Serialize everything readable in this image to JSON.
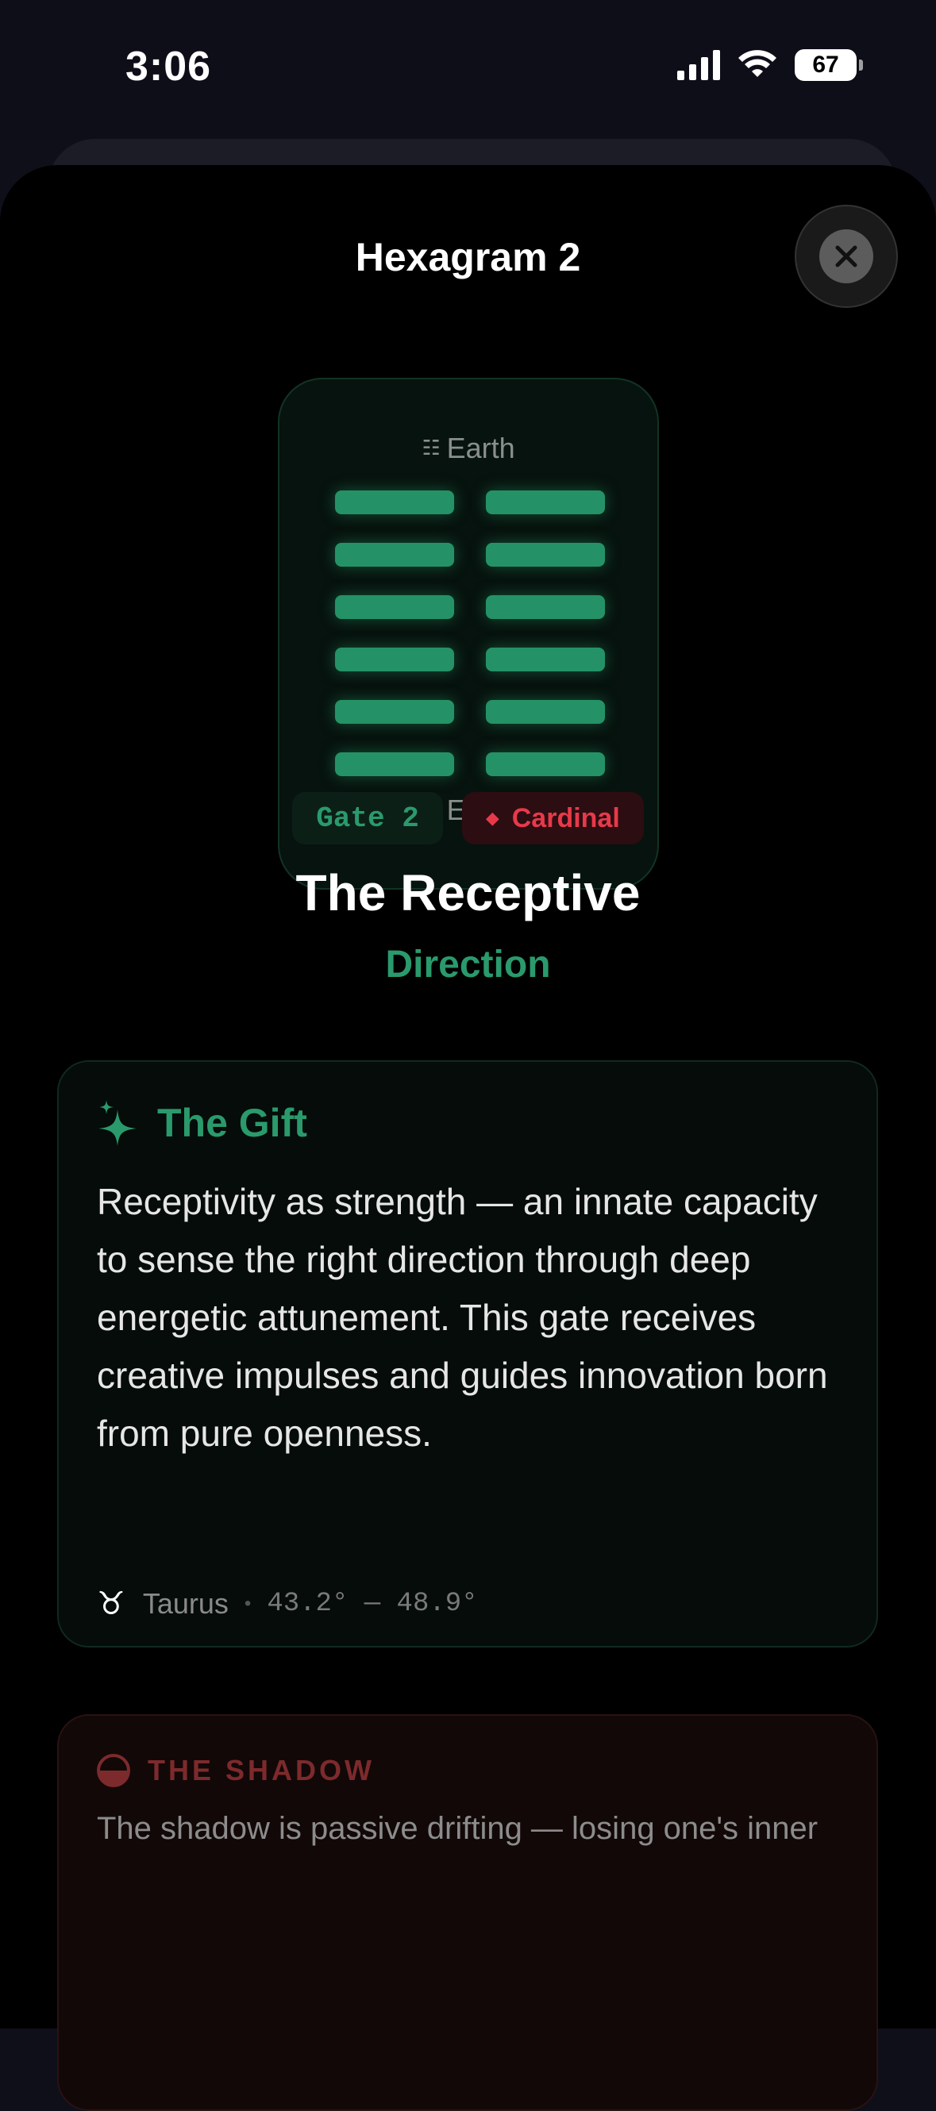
{
  "status_bar": {
    "time": "3:06",
    "battery": "67"
  },
  "sheet": {
    "title": "Hexagram 2",
    "close_label": "✕"
  },
  "hexagram": {
    "upper_trigram": "Earth",
    "lower_trigram": "Earth",
    "trigram_icon": "☷",
    "lines": [
      "yin",
      "yin",
      "yin",
      "yin",
      "yin",
      "yin"
    ],
    "line_color": "#249266"
  },
  "chips": {
    "gate": "Gate 2",
    "mode": "Cardinal",
    "mode_icon": "◆"
  },
  "title": {
    "name": "The Receptive",
    "keynote": "Direction"
  },
  "gift": {
    "title": "The Gift",
    "text": "Receptivity as strength — an innate capacity to sense the right direction through deep energetic attunement. This gate receives creative impulses and guides innovation born from pure openness.",
    "zodiac_glyph": "♉",
    "zodiac_sign": "Taurus",
    "separator": "•",
    "degrees": "43.2° — 48.9°"
  },
  "shadow": {
    "title": "THE SHADOW",
    "text": "The shadow is passive drifting — losing one's inner"
  },
  "colors": {
    "accent_green": "#2a9a6c",
    "accent_red": "#e8394a",
    "shadow_red": "#7d2a2c"
  }
}
